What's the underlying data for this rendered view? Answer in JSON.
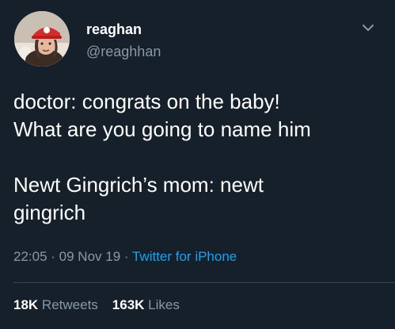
{
  "author": {
    "name": "reaghan",
    "handle": "@reaghhan"
  },
  "tweet": {
    "line1": "doctor: congrats on the baby!",
    "line2": "What are you going to name him",
    "line3": "Newt Gingrich’s mom: newt",
    "line4": "gingrich"
  },
  "meta": {
    "time": "22:05",
    "separator1": " · ",
    "date": "09 Nov 19",
    "separator2": " · ",
    "source": "Twitter for iPhone"
  },
  "stats": {
    "retweets_count": "18K",
    "retweets_label": "Retweets",
    "likes_count": "163K",
    "likes_label": "Likes"
  },
  "colors": {
    "background": "#15202b",
    "text": "#ffffff",
    "secondary": "#8899a6",
    "link": "#1da1f2",
    "divider": "#38444d"
  },
  "icons": {
    "menu": "chevron-down-icon"
  }
}
